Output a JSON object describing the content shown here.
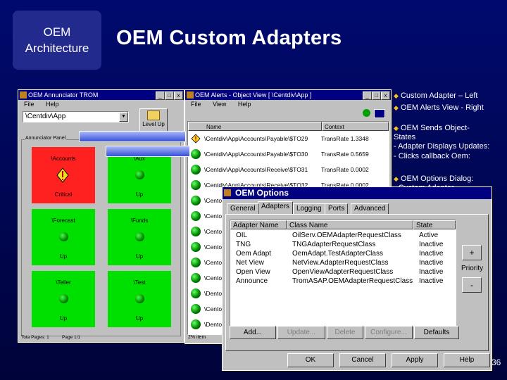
{
  "slide": {
    "arch_line1": "OEM",
    "arch_line2": "Architecture",
    "title": "OEM Custom Adapters",
    "page_number": "36"
  },
  "annunciator": {
    "title": "OEM Annunciator TROM",
    "menu": [
      "File",
      "Help"
    ],
    "path_value": "\\Centdiv\\App",
    "level_up_label": "Level Up",
    "group_label": "Annunciator Panel",
    "panels": [
      {
        "name": "\\Accounts",
        "status": "Critical",
        "color": "#ff2020",
        "alert": true
      },
      {
        "name": "\\Aux",
        "status": "Up",
        "color": "#00e000",
        "alert": false
      },
      {
        "name": "\\Forecast",
        "status": "Up",
        "color": "#00e000",
        "alert": false
      },
      {
        "name": "\\Funds",
        "status": "Up",
        "color": "#00e000",
        "alert": false
      },
      {
        "name": "\\Teller",
        "status": "Up",
        "color": "#00e000",
        "alert": false
      },
      {
        "name": "\\Test",
        "status": "Up",
        "color": "#00e000",
        "alert": false
      }
    ],
    "status_left": "Tota Pages: 1",
    "status_right": "Page 1/1"
  },
  "alerts": {
    "title": "OEM Alerts - Object View [ \\Centdiv\\App ]",
    "menu": [
      "File",
      "View",
      "Help"
    ],
    "col_name": "Name",
    "col_context": "Context",
    "rows": [
      {
        "path": "\\Centdiv\\App\\Accounts\\Payable\\$TO29",
        "context": "TransRate 1.3348",
        "alert": true
      },
      {
        "path": "\\Centdiv\\App\\Accounts\\Payable\\$TO30",
        "context": "TransRate 0.5659",
        "alert": false
      },
      {
        "path": "\\Centdiv\\App\\Accounts\\Receive\\$TO31",
        "context": "TransRate 0.0002",
        "alert": false
      },
      {
        "path": "\\Centdiv\\App\\Accounts\\Receive\\$TO32",
        "context": "TransRate 0.0002",
        "alert": false
      },
      {
        "path": "\\Cento",
        "context": "",
        "alert": false
      },
      {
        "path": "\\Cento",
        "context": "",
        "alert": false
      },
      {
        "path": "\\Cento",
        "context": "",
        "alert": false
      },
      {
        "path": "\\Cento",
        "context": "",
        "alert": false
      },
      {
        "path": "\\Cento",
        "context": "",
        "alert": false
      },
      {
        "path": "\\Cento",
        "context": "",
        "alert": false
      },
      {
        "path": "\\Dento",
        "context": "",
        "alert": false
      },
      {
        "path": "\\Cento",
        "context": "",
        "alert": false
      },
      {
        "path": "\\Dento",
        "context": "",
        "alert": false
      },
      {
        "path": "\\Dento",
        "context": "",
        "alert": false
      }
    ],
    "status": "2% item"
  },
  "options": {
    "title": "OEM Options",
    "tabs": [
      "General",
      "Adapters",
      "Logging",
      "Ports",
      "Advanced"
    ],
    "active_tab": "Adapters",
    "columns": [
      "Adapter Name",
      "Class Name",
      "State"
    ],
    "rows": [
      {
        "name": "OIL",
        "class": "OilServ.OEMAdapterRequestClass",
        "state": "Active"
      },
      {
        "name": "TNG",
        "class": "TNGAdapterRequestClass",
        "state": "Inactive"
      },
      {
        "name": "Oem Adapt",
        "class": "OemAdapt.TestAdapterClass",
        "state": "Inactive"
      },
      {
        "name": "Net View",
        "class": "NetView.AdapterRequestClass",
        "state": "Inactive"
      },
      {
        "name": "Open View",
        "class": "OpenViewAdapterRequestClass",
        "state": "Inactive"
      },
      {
        "name": "Announce",
        "class": "TromASAP.OEMAdapterRequestClass",
        "state": "Inactive"
      }
    ],
    "priority_up": "+",
    "priority_label": "Priority",
    "priority_down": "-",
    "buttons": {
      "add": "Add...",
      "update": "Update...",
      "delete": "Delete",
      "configure": "Configure...",
      "defaults": "Defaults"
    },
    "footer": {
      "ok": "OK",
      "cancel": "Cancel",
      "apply": "Apply",
      "help": "Help"
    }
  },
  "bullets": {
    "b1": "Custom Adapter – Left",
    "b2": "OEM Alerts View - Right",
    "b3": "OEM Sends Object-",
    "b3b": "States",
    "b4": "- Adapter Displays Updates:",
    "b5": "- Clicks callback Oem:",
    "b6": "OEM Options Dialog:",
    "b7": "- Custom Adapter"
  }
}
